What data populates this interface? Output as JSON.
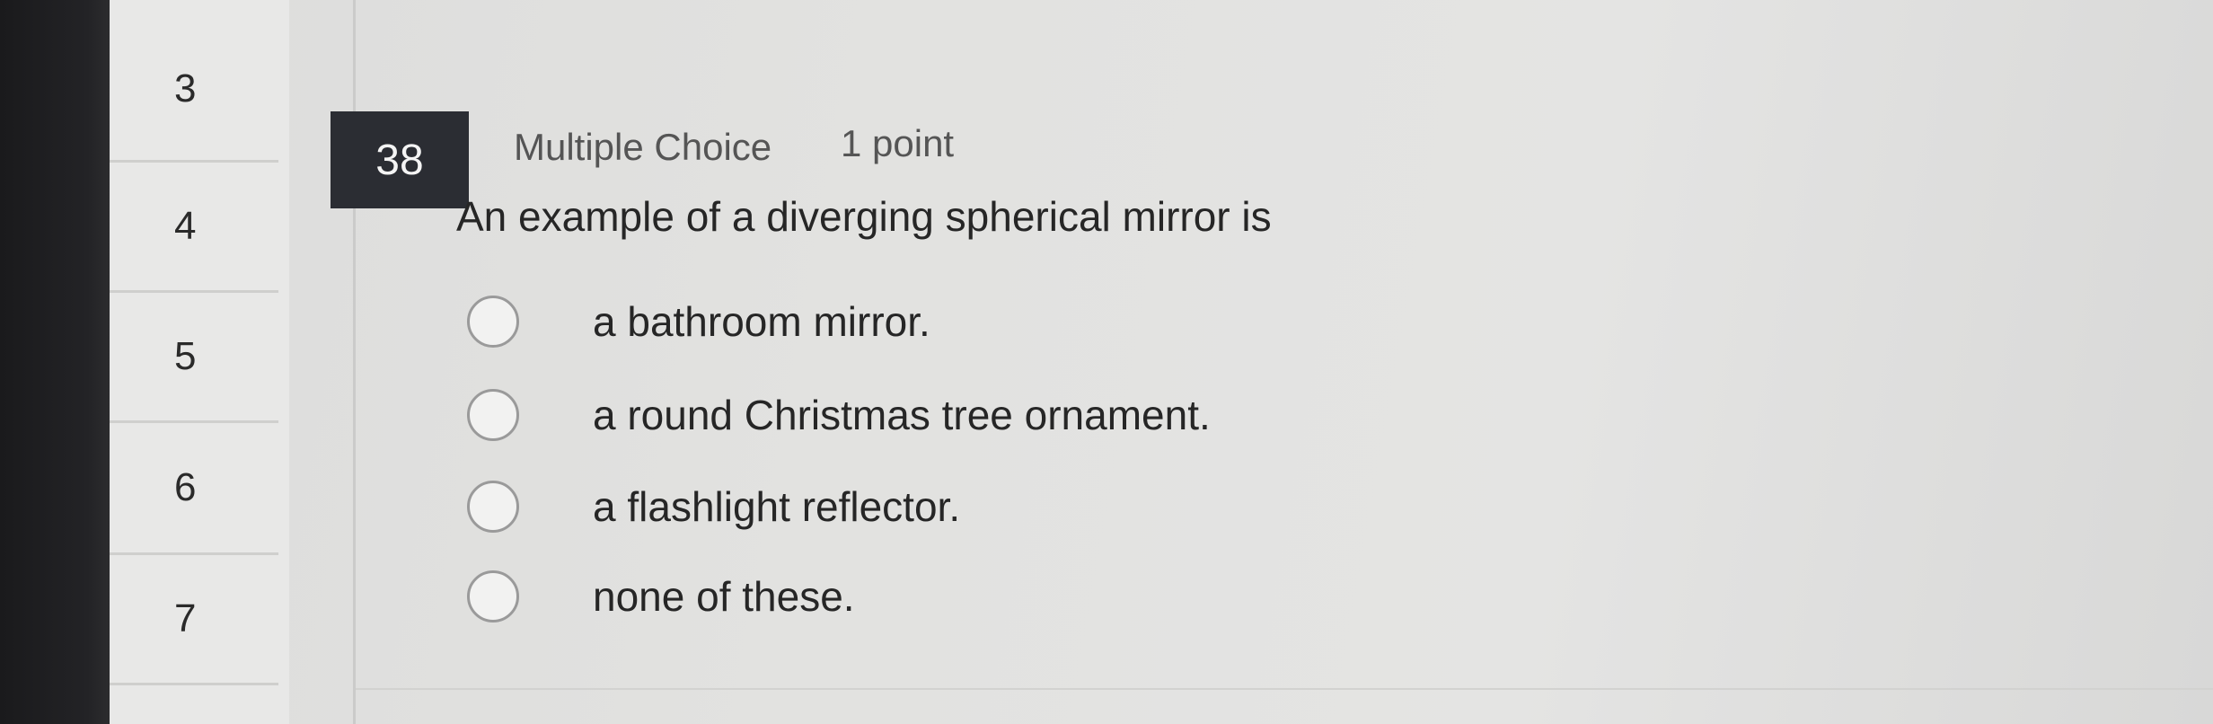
{
  "nav": {
    "items": [
      {
        "label": "3"
      },
      {
        "label": "4"
      },
      {
        "label": "5"
      },
      {
        "label": "6"
      },
      {
        "label": "7"
      }
    ]
  },
  "question": {
    "number": "38",
    "type": "Multiple Choice",
    "points": "1 point",
    "text": "An example of a diverging spherical mirror is",
    "options": [
      {
        "label": "a bathroom mirror."
      },
      {
        "label": "a round Christmas tree ornament."
      },
      {
        "label": "a flashlight reflector."
      },
      {
        "label": "none of these."
      }
    ]
  },
  "colors": {
    "badge_bg": "#2b2d33",
    "badge_text": "#f4f4f4",
    "page_bg": "#e2e2e0",
    "nav_bg": "#e8e8e7"
  },
  "icons": {
    "option_marker": "radio-circle-icon"
  }
}
